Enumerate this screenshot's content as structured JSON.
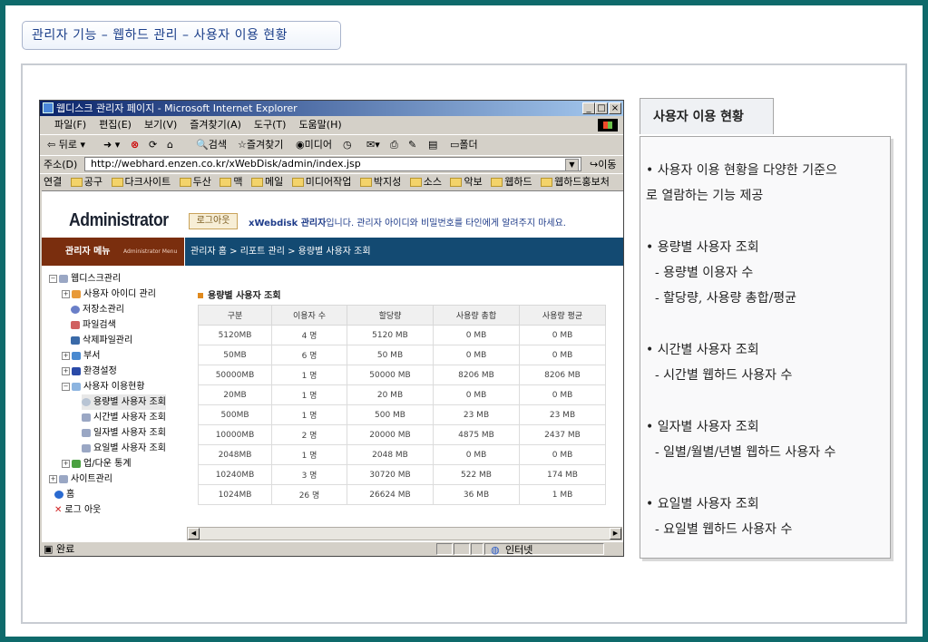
{
  "header": {
    "title": "관리자 기능 – 웹하드 관리 – 사용자 이용 현황"
  },
  "browser": {
    "window_title": "웹디스크 관리자 페이지 - Microsoft Internet Explorer",
    "menu": [
      "파일(F)",
      "편집(E)",
      "보기(V)",
      "즐겨찾기(A)",
      "도구(T)",
      "도움말(H)"
    ],
    "toolbar": {
      "back": "뒤로",
      "search": "검색",
      "favorites": "즐겨찾기",
      "media": "미디어",
      "folder": "폴더"
    },
    "address_label": "주소(D)",
    "address": "http://webhard.enzen.co.kr/xWebDisk/admin/index.jsp",
    "go": "이동",
    "links_label": "연결",
    "links": [
      "공구",
      "다크사이트",
      "두산",
      "맥",
      "메일",
      "미디어작업",
      "박지성",
      "소스",
      "악보",
      "웹하드",
      "웹하드홍보처"
    ],
    "status": "완료",
    "zone": "인터넷"
  },
  "page": {
    "logo": "Administrator",
    "logout": "로그아웃",
    "notice_brand": "xWebdisk 관리자",
    "notice_text": "입니다. 관리자 아이디와 비밀번호를 타인에게 알려주지 마세요.",
    "menu_title": "관리자 메뉴",
    "menu_subtitle": "Administrator Menu",
    "breadcrumb": "관리자 홈 > 리포트 관리 > 용량별 사용자 조회",
    "tree": [
      {
        "label": "웹디스크관리"
      },
      {
        "label": "사용자 아이디 관리"
      },
      {
        "label": "저장소관리"
      },
      {
        "label": "파일검색"
      },
      {
        "label": "삭제파일관리"
      },
      {
        "label": "부서"
      },
      {
        "label": "환경설정"
      },
      {
        "label": "사용자 이용현황"
      },
      {
        "label": "용량별 사용자 조회"
      },
      {
        "label": "시간별 사용자 조회"
      },
      {
        "label": "일자별 사용자 조회"
      },
      {
        "label": "요일별 사용자 조회"
      },
      {
        "label": "업/다운 통계"
      },
      {
        "label": "사이트관리"
      },
      {
        "label": "홈"
      },
      {
        "label": "로그 아웃"
      }
    ],
    "section_title": "용량별 사용자 조회",
    "table": {
      "headers": [
        "구분",
        "이용자 수",
        "할당량",
        "사용량 총합",
        "사용량 평균"
      ],
      "rows": [
        [
          "5120MB",
          "4 명",
          "5120 MB",
          "0 MB",
          "0 MB"
        ],
        [
          "50MB",
          "6 명",
          "50 MB",
          "0 MB",
          "0 MB"
        ],
        [
          "50000MB",
          "1 명",
          "50000 MB",
          "8206 MB",
          "8206 MB"
        ],
        [
          "20MB",
          "1 명",
          "20 MB",
          "0 MB",
          "0 MB"
        ],
        [
          "500MB",
          "1 명",
          "500 MB",
          "23 MB",
          "23 MB"
        ],
        [
          "10000MB",
          "2 명",
          "20000 MB",
          "4875 MB",
          "2437 MB"
        ],
        [
          "2048MB",
          "1 명",
          "2048 MB",
          "0 MB",
          "0 MB"
        ],
        [
          "10240MB",
          "3 명",
          "30720 MB",
          "522 MB",
          "174 MB"
        ],
        [
          "1024MB",
          "26 명",
          "26624 MB",
          "36 MB",
          "1 MB"
        ]
      ]
    }
  },
  "description": {
    "title": "사용자 이용 현황",
    "lines": [
      "• 사용자 이용 현황을 다양한 기준으",
      "로 열람하는 기능 제공",
      "• 용량별 사용자 조회",
      "- 용량별 이용자 수",
      "- 할당량, 사용량 총합/평균",
      "• 시간별 사용자 조회",
      "- 시간별 웹하드 사용자 수",
      "• 일자별 사용자 조회",
      "- 일별/월별/년별 웹하드 사용자 수",
      "• 요일별 사용자 조회",
      "- 요일별 웹하드 사용자 수"
    ]
  }
}
